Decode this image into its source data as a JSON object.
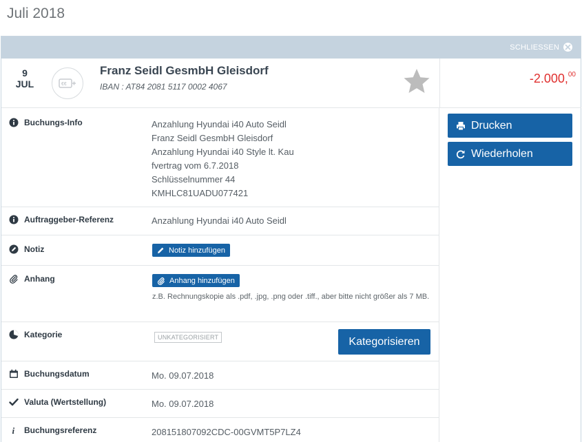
{
  "header": {
    "month": "Juli 2018"
  },
  "panel": {
    "close_label": "SCHLIESSEN"
  },
  "transaction": {
    "day": "9",
    "month_abbr": "JUL",
    "payee": "Franz Seidl GesmbH Gleisdorf",
    "iban": "IBAN : AT84 2081 5117 0002 4067",
    "amount_main": "-2.000,",
    "amount_cents": "00",
    "amount_color": "#e0302f",
    "favorite_icon": "star-icon"
  },
  "actions": {
    "print_label": "Drucken",
    "repeat_label": "Wiederholen"
  },
  "details": {
    "buchungs_info": {
      "label": "Buchungs-Info",
      "lines": [
        "Anzahlung Hyundai i40 Auto Seidl",
        "Franz Seidl GesmbH Gleisdorf",
        "Anzahlung Hyundai i40 Style lt. Kau",
        "fvertrag vom 6.7.2018",
        "Schlüsselnummer 44",
        "KMHLC81UADU077421"
      ]
    },
    "auftraggeber": {
      "label": "Auftraggeber-Referenz",
      "value": "Anzahlung Hyundai i40 Auto Seidl"
    },
    "notiz": {
      "label": "Notiz",
      "button": "Notiz hinzufügen"
    },
    "anhang": {
      "label": "Anhang",
      "button": "Anhang hinzufügen",
      "hint": "z.B. Rechnungskopie als .pdf, .jpg, .png oder .tiff., aber bitte nicht größer als 7 MB."
    },
    "kategorie": {
      "label": "Kategorie",
      "badge": "UNKATEGORISIERT",
      "button": "Kategorisieren"
    },
    "buchungsdatum": {
      "label": "Buchungsdatum",
      "value": "Mo. 09.07.2018"
    },
    "valuta": {
      "label": "Valuta (Wertstellung)",
      "value": "Mo. 09.07.2018"
    },
    "buchungsreferenz": {
      "label": "Buchungsreferenz",
      "value": "208151807092CDC-00GVMT5P7LZ4"
    }
  },
  "colors": {
    "accent": "#1763a6",
    "header_bar": "#c5d3df"
  }
}
